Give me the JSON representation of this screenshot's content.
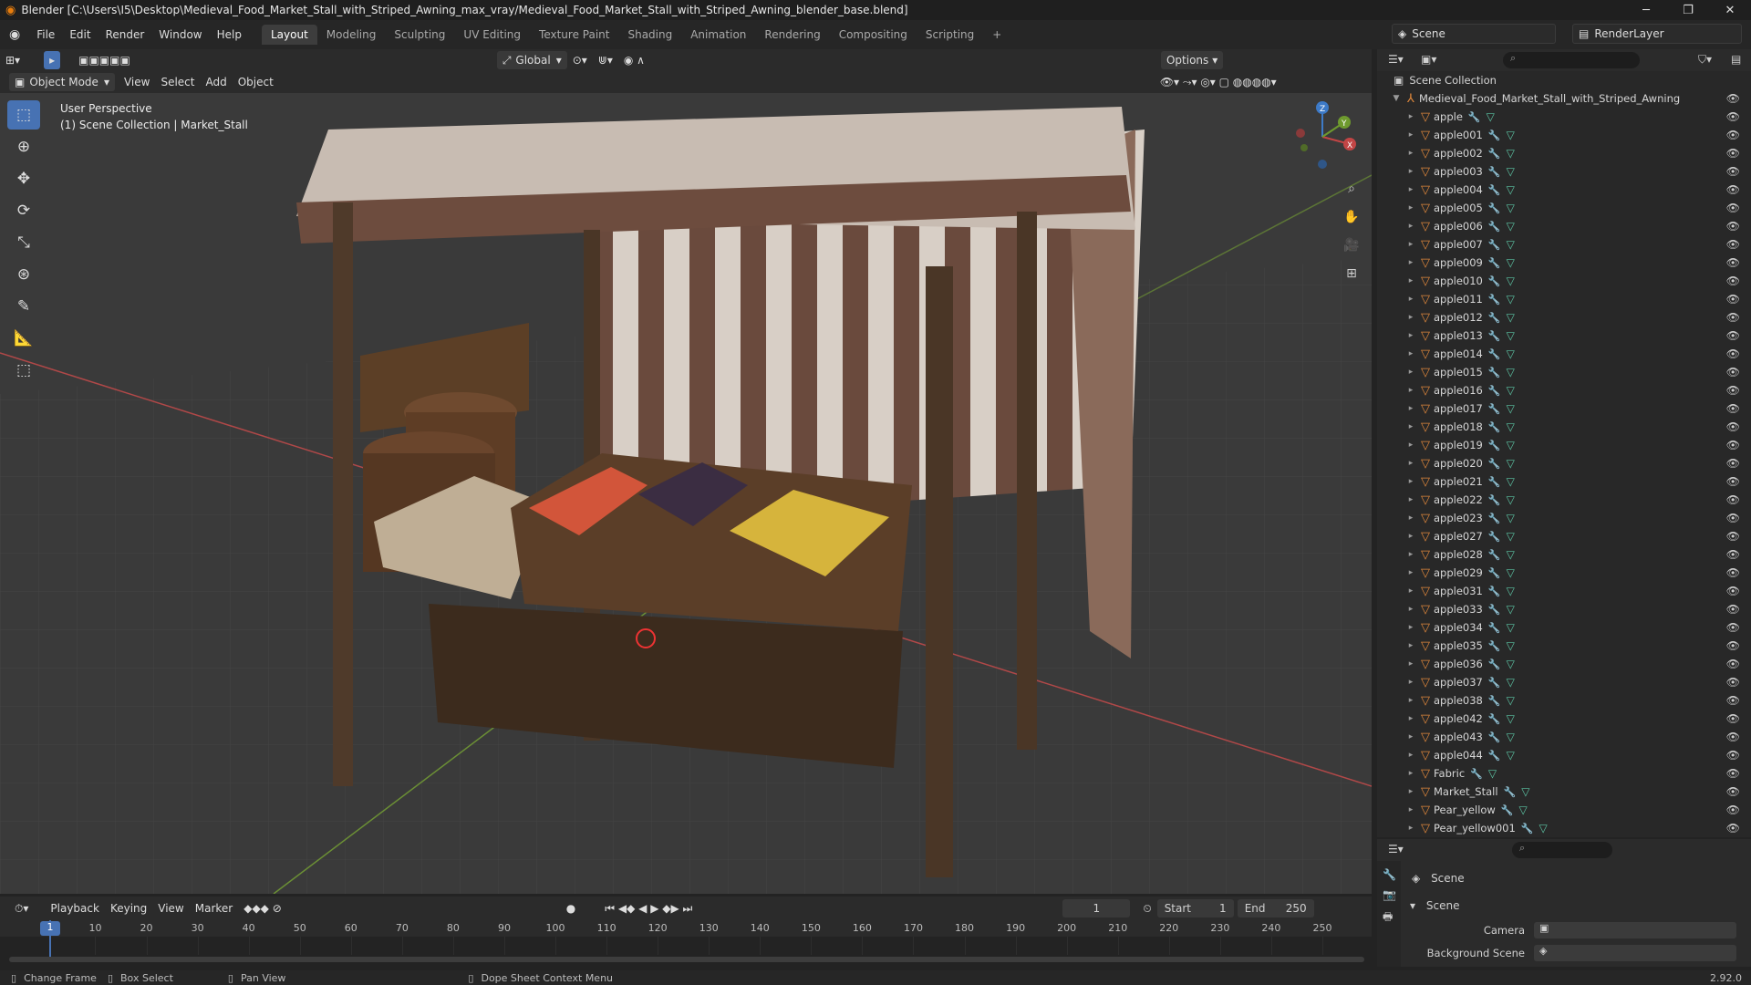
{
  "window": {
    "title": "Blender [C:\\Users\\I5\\Desktop\\Medieval_Food_Market_Stall_with_Striped_Awning_max_vray/Medieval_Food_Market_Stall_with_Striped_Awning_blender_base.blend]"
  },
  "menu": [
    "File",
    "Edit",
    "Render",
    "Window",
    "Help"
  ],
  "workspaces": [
    "Layout",
    "Modeling",
    "Sculpting",
    "UV Editing",
    "Texture Paint",
    "Shading",
    "Animation",
    "Rendering",
    "Compositing",
    "Scripting"
  ],
  "active_workspace": "Layout",
  "scene_name": "Scene",
  "render_layer": "RenderLayer",
  "viewport_header": {
    "mode": "Object Mode",
    "menus": [
      "View",
      "Select",
      "Add",
      "Object"
    ],
    "orientation": "Global",
    "options": "Options"
  },
  "viewport": {
    "perspective": "User Perspective",
    "collection_info": "(1) Scene Collection | Market_Stall"
  },
  "gizmo": {
    "x": "X",
    "y": "Y",
    "z": "Z"
  },
  "outliner": {
    "root": "Scene Collection",
    "collection": "Medieval_Food_Market_Stall_with_Striped_Awning",
    "items": [
      "apple",
      "apple001",
      "apple002",
      "apple003",
      "apple004",
      "apple005",
      "apple006",
      "apple007",
      "apple009",
      "apple010",
      "apple011",
      "apple012",
      "apple013",
      "apple014",
      "apple015",
      "apple016",
      "apple017",
      "apple018",
      "apple019",
      "apple020",
      "apple021",
      "apple022",
      "apple023",
      "apple027",
      "apple028",
      "apple029",
      "apple031",
      "apple033",
      "apple034",
      "apple035",
      "apple036",
      "apple037",
      "apple038",
      "apple042",
      "apple043",
      "apple044",
      "Fabric",
      "Market_Stall",
      "Pear_yellow",
      "Pear_yellow001"
    ]
  },
  "properties": {
    "title": "Scene",
    "section": "Scene",
    "camera_label": "Camera",
    "bg_label": "Background Scene"
  },
  "timeline": {
    "menus": [
      "Playback",
      "Keying",
      "View",
      "Marker"
    ],
    "current_frame": "1",
    "start_label": "Start",
    "start": "1",
    "end_label": "End",
    "end": "250",
    "ticks": [
      "1",
      "10",
      "20",
      "30",
      "40",
      "50",
      "60",
      "70",
      "80",
      "90",
      "100",
      "110",
      "120",
      "130",
      "140",
      "150",
      "160",
      "170",
      "180",
      "190",
      "200",
      "210",
      "220",
      "230",
      "240",
      "250"
    ]
  },
  "status": {
    "change_frame": "Change Frame",
    "box_select": "Box Select",
    "pan_view": "Pan View",
    "context_menu": "Dope Sheet Context Menu",
    "version": "2.92.0"
  }
}
